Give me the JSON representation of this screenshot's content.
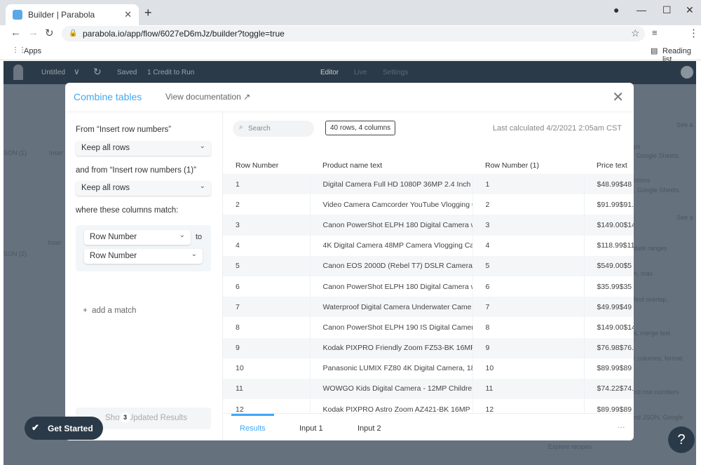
{
  "browser": {
    "tab_title": "Builder | Parabola",
    "url": "parabola.io/app/flow/6027eD6mJz/builder?toggle=true",
    "bookmarks": {
      "apps": "Apps",
      "reading_list": "Reading list"
    }
  },
  "app": {
    "flow_name": "Untitled",
    "saved": "Saved",
    "credits": "1 Credit to Run",
    "nav": [
      "Editor",
      "Live",
      "Settings"
    ]
  },
  "background": {
    "left": [
      "SON (1)",
      "Inser",
      "Inser",
      "SON (2)"
    ],
    "right": [
      "See a",
      "ps",
      "Google Sheets,",
      "ctions",
      ", Google Sheets,",
      "See a",
      "date ranges",
      "n, max",
      "find overlap,",
      "s, merge text",
      "r columns, format",
      "nd row numbers",
      "nd JSON, Google",
      "Explore recipes"
    ]
  },
  "modal": {
    "title": "Combine tables",
    "doc_link": "View documentation",
    "left": {
      "from_label": "From “Insert row numbers”",
      "from_value": "Keep all rows",
      "and_label": "and from “Insert row numbers (1)”",
      "and_value": "Keep all rows",
      "where_label": "where these columns match:",
      "match_left": "Row Number",
      "to": "to",
      "match_right": "Row Number",
      "add_match": "add a match",
      "show_results": "Show Updated Results"
    },
    "right": {
      "search_placeholder": "Search",
      "badge": "40 rows, 4 columns",
      "last_calculated": "Last calculated 4/2/2021 2:05am CST",
      "columns": [
        "Row Number",
        "Product name text",
        "Row Number (1)",
        "Price text"
      ],
      "rows": [
        [
          "1",
          "Digital Camera Full HD 1080P 36MP 2.4 Inch V",
          "1",
          "$48.99$48"
        ],
        [
          "2",
          "Video Camera Camcorder YouTube Vlogging C",
          "2",
          "$91.99$91."
        ],
        [
          "3",
          "Canon PowerShot ELPH 180 Digital Camera w",
          "3",
          "$149.00$14"
        ],
        [
          "4",
          "4K Digital Camera 48MP Camera Vlogging Car",
          "4",
          "$118.99$11"
        ],
        [
          "5",
          "Canon EOS 2000D (Rebel T7) DSLR Camera w",
          "5",
          "$549.00$5"
        ],
        [
          "6",
          "Canon PowerShot ELPH 180 Digital Camera w",
          "6",
          "$35.99$35"
        ],
        [
          "7",
          "Waterproof Digital Camera Underwater Came",
          "7",
          "$49.99$49"
        ],
        [
          "8",
          "Canon PowerShot ELPH 190 IS Digital Camera",
          "8",
          "$149.00$14"
        ],
        [
          "9",
          "Kodak PIXPRO Friendly Zoom FZ53-BK 16MP D",
          "9",
          "$76.98$76."
        ],
        [
          "10",
          "Panasonic LUMIX FZ80 4K Digital Camera, 18.1",
          "10",
          "$89.99$89"
        ],
        [
          "11",
          "WOWGO Kids Digital Camera - 12MP Children's",
          "11",
          "$74.22$74."
        ],
        [
          "12",
          "Kodak PIXPRO Astro Zoom AZ421-BK 16MP Dig",
          "12",
          "$89.99$89"
        ]
      ],
      "tabs": [
        "Results",
        "Input 1",
        "Input 2"
      ],
      "more": "…"
    }
  },
  "get_started": {
    "label": "Get Started",
    "count": "3"
  },
  "help": "?"
}
